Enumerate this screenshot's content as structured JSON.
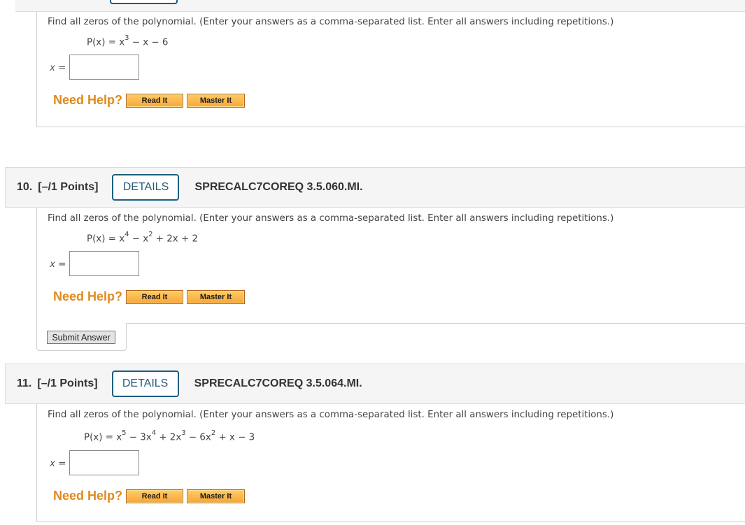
{
  "questions": [
    {
      "prompt": "Find all zeros of the polynomial. (Enter your answers as a comma-separated list. Enter all answers including repetitions.)",
      "equation_lhs": "P(x) = ",
      "terms": {
        "t1": "x",
        "t1_exp": "3",
        "t2": " − x − 6"
      },
      "answer_label": "x =",
      "answer_value": "",
      "need_help": "Need Help?",
      "read_it": "Read It",
      "master_it": "Master It"
    },
    {
      "number": "10.",
      "points": "[–/1 Points]",
      "details": "DETAILS",
      "code": "SPRECALC7COREQ 3.5.060.MI.",
      "prompt": "Find all zeros of the polynomial. (Enter your answers as a comma-separated list. Enter all answers including repetitions.)",
      "equation_lhs": "P(x) = ",
      "terms": {
        "t1": "x",
        "t1_exp": "4",
        "t2": " − x",
        "t2_exp": "2",
        "t3": " + 2x + 2"
      },
      "answer_label": "x =",
      "answer_value": "",
      "need_help": "Need Help?",
      "read_it": "Read It",
      "master_it": "Master It",
      "submit": "Submit Answer"
    },
    {
      "number": "11.",
      "points": "[–/1 Points]",
      "details": "DETAILS",
      "code": "SPRECALC7COREQ 3.5.064.MI.",
      "prompt": "Find all zeros of the polynomial. (Enter your answers as a comma-separated list. Enter all answers including repetitions.)",
      "equation_lhs": "P(x) = ",
      "terms": {
        "t1": "x",
        "t1_exp": "5",
        "t2": " − 3x",
        "t2_exp": "4",
        "t3": " + 2x",
        "t3_exp": "3",
        "t4": " − 6x",
        "t4_exp": "2",
        "t5": " + x − 3"
      },
      "answer_label": "x =",
      "answer_value": "",
      "need_help": "Need Help?",
      "read_it": "Read It",
      "master_it": "Master It"
    }
  ]
}
